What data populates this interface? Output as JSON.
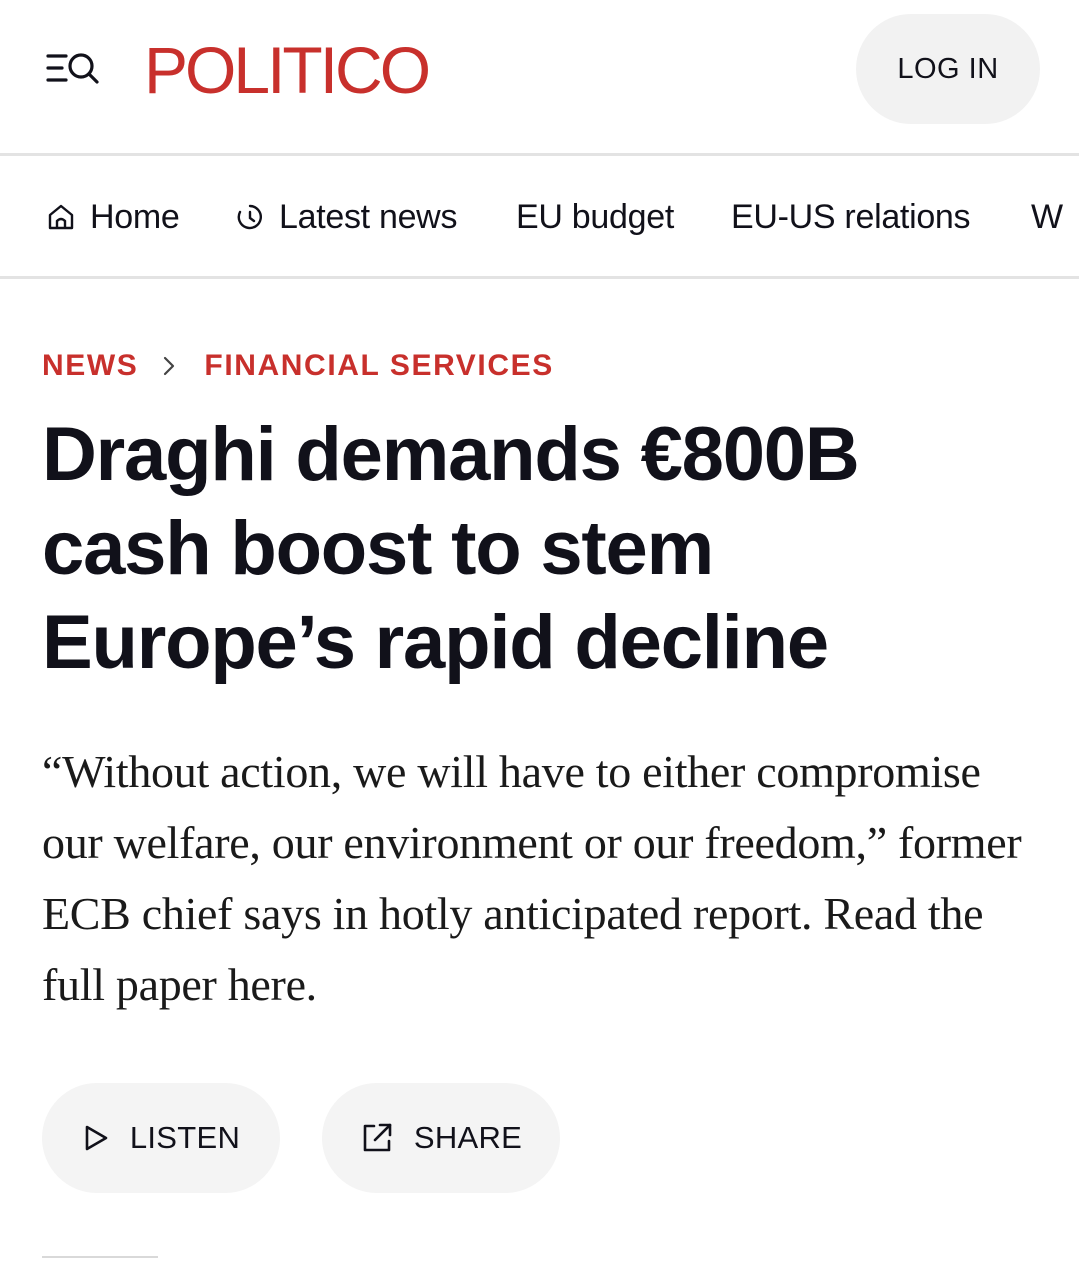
{
  "header": {
    "menu_icon": "menu-search-icon",
    "logo": "POLITICO",
    "login_label": "LOG IN"
  },
  "nav": {
    "items": [
      {
        "label": "Home",
        "icon": "home-icon"
      },
      {
        "label": "Latest news",
        "icon": "clock-icon"
      },
      {
        "label": "EU budget"
      },
      {
        "label": "EU-US relations"
      },
      {
        "label": "W"
      }
    ]
  },
  "breadcrumb": {
    "section": "NEWS",
    "subsection": "FINANCIAL SERVICES"
  },
  "article": {
    "headline": "Draghi demands €800B cash boost to stem Europe’s rapid decline",
    "dek": "“Without action, we will have to either compromise our welfare, our environment or our freedom,” former ECB chief says in hotly anticipated report. Read the full paper here."
  },
  "actions": {
    "listen_label": "LISTEN",
    "share_label": "SHARE"
  },
  "colors": {
    "brand_red": "#c8302c",
    "text": "#11111a",
    "pill_bg": "#f4f4f4"
  }
}
